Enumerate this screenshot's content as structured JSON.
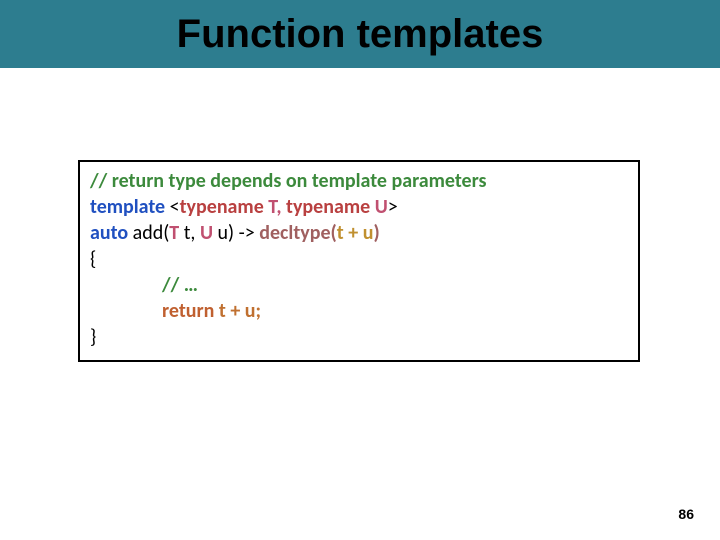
{
  "title": "Function templates",
  "code": {
    "line1_comment": "// return type depends on template parameters",
    "line2_template_kw": "template ",
    "line2_langle": "<",
    "line2_typename1": "typename ",
    "line2_T": "T, ",
    "line2_typename2": "typename ",
    "line2_U": "U",
    "line2_rangle": ">",
    "line3_auto": "auto ",
    "line3_add": "add(",
    "line3_Tparam": "T ",
    "line3_t": "t, ",
    "line3_Uparam": "U ",
    "line3_u": "u) -> ",
    "line3_decltype": "decltype(",
    "line3_expr": "t + u",
    "line3_close": ")",
    "line4": "{",
    "line5_comment": "// …",
    "line6_return": "return ",
    "line6_expr": "t + u;",
    "line7": "}"
  },
  "page_number": "86"
}
